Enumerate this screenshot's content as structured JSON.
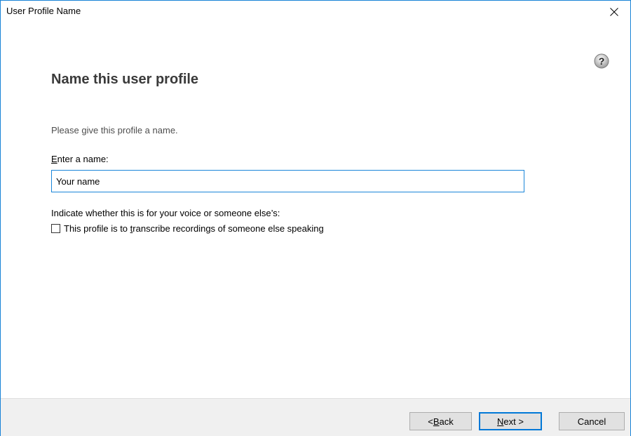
{
  "window": {
    "title": "User Profile Name",
    "close_glyph": "✕"
  },
  "help": {
    "icon": "question-mark-circle",
    "glyph": "?"
  },
  "page": {
    "heading": "Name this user profile",
    "instruction": "Please give this profile a name.",
    "name_label_accel": "E",
    "name_label_rest": "nter a name:",
    "name_value": "Your name",
    "voice_question": "Indicate whether this is for your voice or someone else’s:",
    "checkbox_pre": "This profile is to ",
    "checkbox_accel": "t",
    "checkbox_post": "ranscribe recordings of someone else speaking",
    "checkbox_checked": false
  },
  "buttons": {
    "back_prefix": "< ",
    "back_accel": "B",
    "back_rest": "ack",
    "next_accel": "N",
    "next_rest": "ext >",
    "cancel": "Cancel"
  },
  "colors": {
    "accent": "#0078d7",
    "footer_bg": "#f0f0f0"
  }
}
